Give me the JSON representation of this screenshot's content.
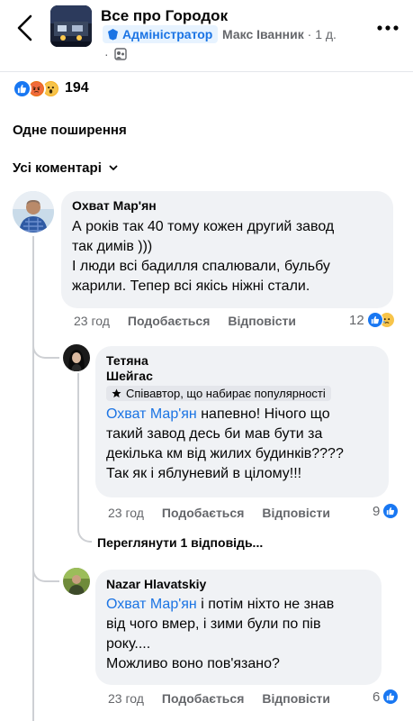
{
  "header": {
    "title": "Все про Городок",
    "admin_badge": "Адміністратор",
    "author": "Макс Іванник",
    "time": "· 1 д.",
    "dot": "·"
  },
  "reactions": {
    "count": "194"
  },
  "shares_label": "Одне поширення",
  "sort_label": "Усі коментарі",
  "comments": [
    {
      "name": "Охват Мар'ян",
      "text_lines": [
        "А років так 40 тому кожен другий завод",
        "так димів )))",
        "І люди всі бадилля спалювали, бульбу",
        "жарили. Тепер всі якісь ніжні стали."
      ],
      "time": "23 год",
      "like": "Подобається",
      "reply": "Відповісти",
      "reaction_count": "12"
    },
    {
      "name_line1": "Тетяна",
      "name_line2": "Шейгас",
      "badge": "Співавтор, що набирає популярності",
      "mention": "Охват Мар'ян",
      "text_lines": [
        " напевно! Нічого що",
        "такий завод десь би мав бути за",
        "декілька км від жилих будинків????",
        "Так як і яблуневий в цілому!!!"
      ],
      "time": "23 год",
      "like": "Подобається",
      "reply": "Відповісти",
      "reaction_count": "9"
    },
    {
      "name": "Nazar Hlavatskiy",
      "mention": "Охват Мар'ян",
      "text_lines": [
        " і потім ніхто не знав",
        "від чого вмер, і зими були по пів",
        "року....",
        "Можливо воно пов'язано?"
      ],
      "time": "23 год",
      "like": "Подобається",
      "reply": "Відповісти",
      "reaction_count": "6"
    }
  ],
  "more_replies": "Переглянути 1 відповідь...",
  "colors": {
    "accent": "#1b74e4",
    "bubble": "#f0f2f5",
    "muted": "#65676b"
  }
}
